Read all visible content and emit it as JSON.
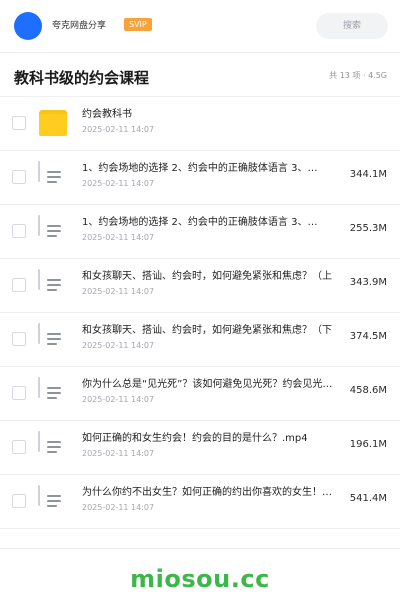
{
  "topbar": {
    "owner": "夸克网盘分享",
    "badge": "SVIP",
    "search_placeholder": "搜索"
  },
  "header": {
    "title": "教科书级的约会课程",
    "summary": "共 13 项 · 4.5G"
  },
  "files": [
    {
      "icon": "folder-icon",
      "name": "约会教科书",
      "date": "2025-02-11 14:07",
      "size": ""
    },
    {
      "icon": "document-icon",
      "name": "1、约会场地的选择 2、约会中的正确肢体语言 3、…",
      "date": "2025-02-11 14:07",
      "size": "344.1M"
    },
    {
      "icon": "document-icon",
      "name": "1、约会场地的选择 2、约会中的正确肢体语言 3、…",
      "date": "2025-02-11 14:07",
      "size": "255.3M"
    },
    {
      "icon": "document-icon",
      "name": "和女孩聊天、搭讪、约会时，如何避免紧张和焦虑？（上",
      "date": "2025-02-11 14:07",
      "size": "343.9M"
    },
    {
      "icon": "document-icon",
      "name": "和女孩聊天、搭讪、约会时，如何避免紧张和焦虑？（下",
      "date": "2025-02-11 14:07",
      "size": "374.5M"
    },
    {
      "icon": "document-icon",
      "name": "你为什么总是“见光死”？该如何避免见光死？约会见光…",
      "date": "2025-02-11 14:07",
      "size": "458.6M"
    },
    {
      "icon": "document-icon",
      "name": "如何正确的和女生约会！约会的目的是什么？.mp4",
      "date": "2025-02-11 14:07",
      "size": "196.1M"
    },
    {
      "icon": "document-icon",
      "name": "为什么你约不出女生？如何正确的约出你喜欢的女生！…",
      "date": "2025-02-11 14:07",
      "size": "541.4M"
    }
  ],
  "watermark": "miosou.cc",
  "colors": {
    "accent": "#1e6fff",
    "badge": "#f7a23a",
    "folder": "#ffcc1f",
    "watermark": "#3cb84a"
  }
}
